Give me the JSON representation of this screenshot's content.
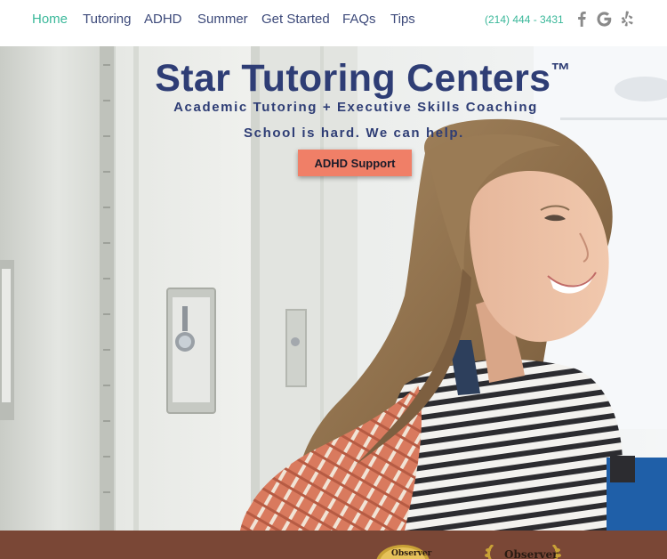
{
  "nav": {
    "items": [
      {
        "label": "Home",
        "active": true
      },
      {
        "label": "Tutoring",
        "active": false
      },
      {
        "label": "ADHD",
        "active": false
      },
      {
        "label": "Summer",
        "active": false
      },
      {
        "label": "Get Started",
        "active": false
      },
      {
        "label": "FAQs",
        "active": false
      },
      {
        "label": "Tips",
        "active": false
      }
    ],
    "phone": "(214) 444 - 3431",
    "social": [
      {
        "icon": "facebook-icon"
      },
      {
        "icon": "google-icon"
      },
      {
        "icon": "yelp-icon"
      }
    ]
  },
  "hero": {
    "title": "Star Tutoring Centers",
    "trademark": "™",
    "subtitle": "Academic Tutoring + Executive Skills Coaching",
    "tagline": "School is hard. We can help.",
    "cta_label": "ADHD Support",
    "image": "student-at-lockers-photo"
  },
  "awards": [
    {
      "label": "Observer",
      "icon": "award-seal-icon"
    },
    {
      "label": "Observer",
      "icon": "laurel-wreath-icon"
    }
  ],
  "colors": {
    "nav_text": "#3d4a7a",
    "nav_active": "#3bb89a",
    "title": "#2e3d75",
    "cta_bg": "#f07f67",
    "band_bg": "#7a4736"
  }
}
